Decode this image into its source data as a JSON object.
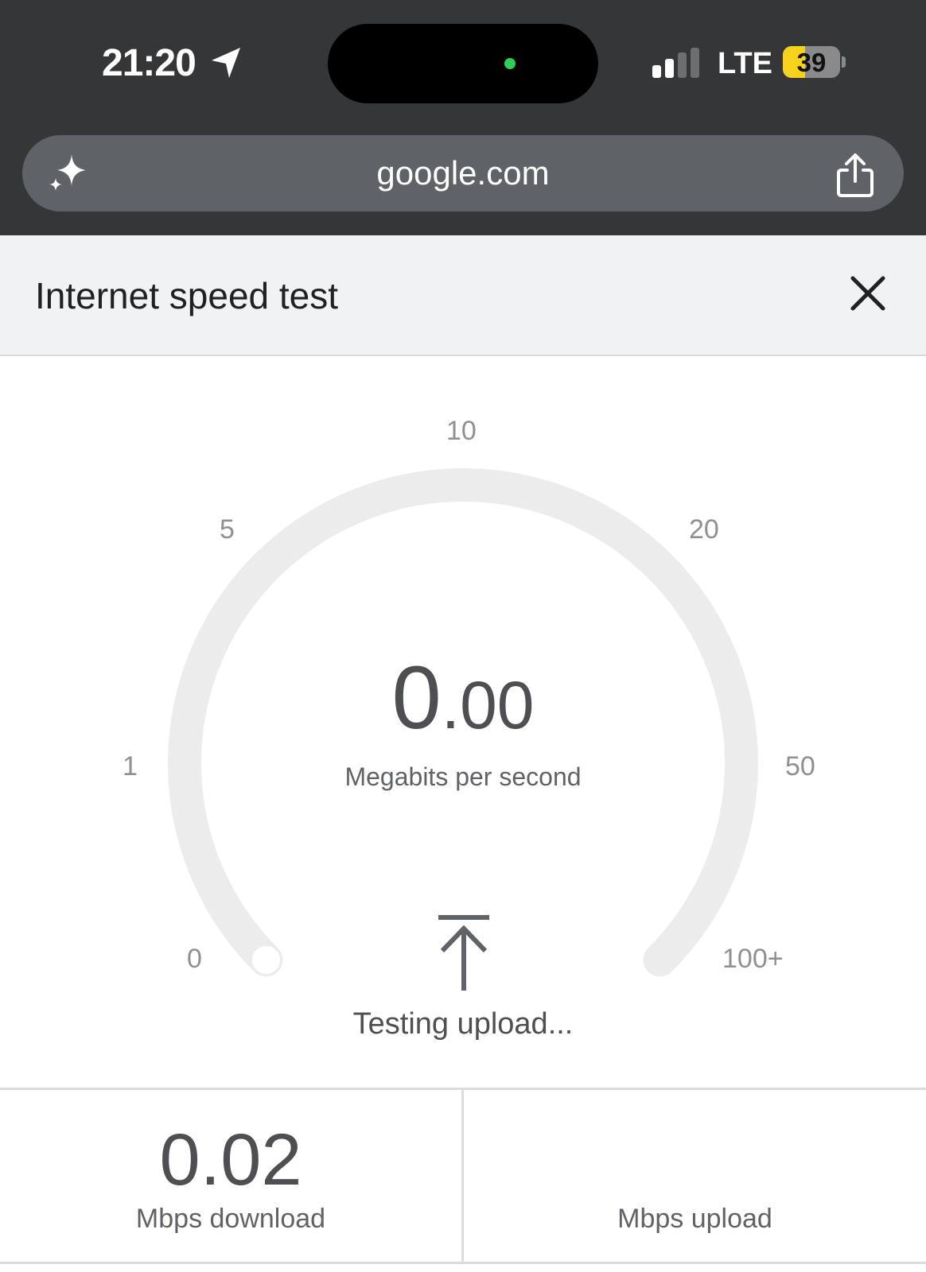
{
  "status_bar": {
    "time": "21:20",
    "network": "LTE",
    "battery_level": "39",
    "battery_fraction": 0.39,
    "signal_bars_active": 2,
    "icons": [
      "location-arrow-icon",
      "signal-icon",
      "battery-icon"
    ]
  },
  "browser": {
    "url": "google.com",
    "icons": [
      "sparkle-icon",
      "share-icon"
    ]
  },
  "panel": {
    "title": "Internet speed test",
    "close_icon": "close-icon"
  },
  "gauge": {
    "ticks": [
      "0",
      "1",
      "5",
      "10",
      "20",
      "50",
      "100+"
    ],
    "value_int": "0",
    "value_dec": ".00",
    "unit": "Megabits per second",
    "status": "Testing upload...",
    "status_icon": "upload-arrow-icon",
    "needle_fraction": 0,
    "track_color": "#ececec"
  },
  "results": {
    "download_value": "0.02",
    "download_label": "Mbps download",
    "upload_value": "",
    "upload_label": "Mbps upload"
  }
}
